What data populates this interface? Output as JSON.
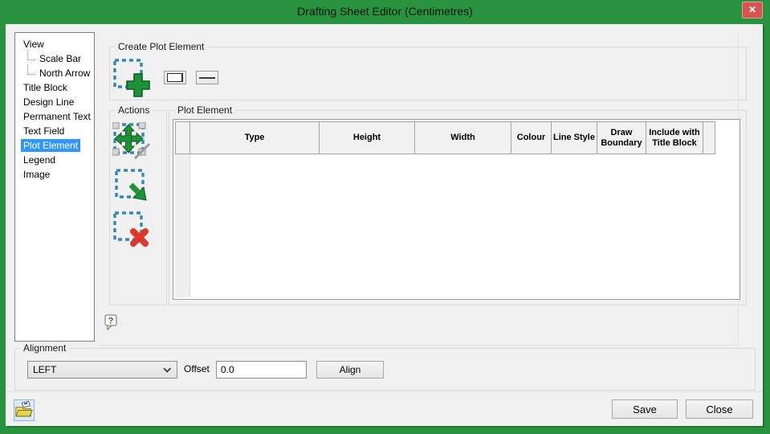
{
  "window": {
    "title": "Drafting Sheet Editor (Centimetres)"
  },
  "icons": {
    "close": "✕",
    "add_plot_element": "dashed-square-plus",
    "rectangle_tool": "rectangle",
    "line_tool": "horizontal-line",
    "move": "dashed-square-move-arrows",
    "resize": "dashed-square-diagonal-arrow",
    "delete": "dashed-square-red-x",
    "help": "question-bubble",
    "open_folder": "open-folder"
  },
  "tree": {
    "items": [
      {
        "label": "View",
        "level": 0,
        "selected": false
      },
      {
        "label": "Scale Bar",
        "level": 1,
        "selected": false
      },
      {
        "label": "North Arrow",
        "level": 1,
        "selected": false
      },
      {
        "label": "Title Block",
        "level": 0,
        "selected": false
      },
      {
        "label": "Design Line",
        "level": 0,
        "selected": false
      },
      {
        "label": "Permanent Text",
        "level": 0,
        "selected": false
      },
      {
        "label": "Text Field",
        "level": 0,
        "selected": false
      },
      {
        "label": "Plot Element",
        "level": 0,
        "selected": true
      },
      {
        "label": "Legend",
        "level": 0,
        "selected": false
      },
      {
        "label": "Image",
        "level": 0,
        "selected": false
      }
    ]
  },
  "create_group": {
    "label": "Create Plot Element"
  },
  "actions_group": {
    "label": "Actions"
  },
  "plot_group": {
    "label": "Plot Element",
    "columns": [
      "",
      "Type",
      "Height",
      "Width",
      "Colour",
      "Line Style",
      "Draw Boundary",
      "Include with Title Block",
      ""
    ],
    "rows": []
  },
  "help": {
    "glyph": "?"
  },
  "alignment": {
    "label": "Alignment",
    "value": "LEFT",
    "offset_label": "Offset",
    "offset_value": "0.0",
    "align_label": "Align"
  },
  "footer": {
    "save_label": "Save",
    "close_label": "Close"
  },
  "colors": {
    "titlebar_green": "#28923e",
    "frame_shadow_green": "#1d7433",
    "selection_blue": "#3296ff",
    "close_button_red": "#d9534e",
    "icon_green": "#1f9238",
    "icon_red": "#d93a2b",
    "dashed_icon_blue": "#3389b0"
  }
}
